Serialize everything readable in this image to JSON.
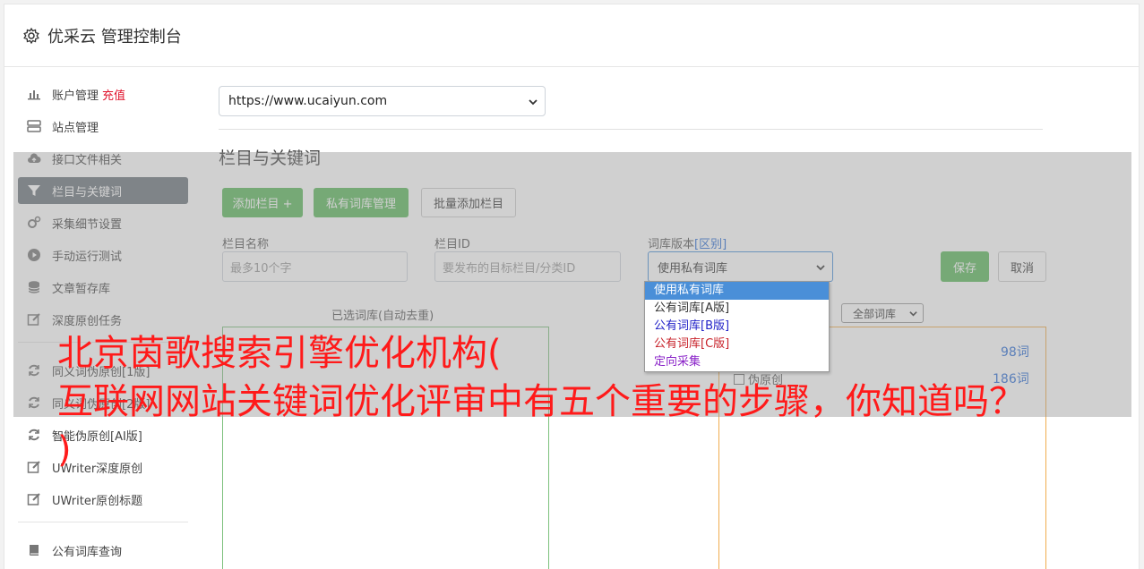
{
  "header": {
    "title": "优采云 管理控制台"
  },
  "sidebar": {
    "items": [
      {
        "label": "账户管理",
        "extra": "充值"
      },
      {
        "label": "站点管理"
      },
      {
        "label": "接口文件相关"
      },
      {
        "label": "栏目与关键词"
      },
      {
        "label": "采集细节设置"
      },
      {
        "label": "手动运行测试"
      },
      {
        "label": "文章暂存库"
      },
      {
        "label": "深度原创任务"
      },
      {
        "label": "同义词伪原创[1版]"
      },
      {
        "label": "同义词伪原创[2版]"
      },
      {
        "label": "智能伪原创[AI版]"
      },
      {
        "label": "UWriter深度原创"
      },
      {
        "label": "UWriter原创标题"
      },
      {
        "label": "公有词库查询"
      }
    ]
  },
  "main": {
    "site_select_value": "https://www.ucaiyun.com",
    "section_title": "栏目与关键词",
    "buttons": {
      "add_column": "添加栏目 +",
      "private_dict": "私有词库管理",
      "batch_add": "批量添加栏目",
      "save": "保存",
      "cancel": "取消"
    },
    "fields": {
      "column_name_label": "栏目名称",
      "column_name_placeholder": "最多10个字",
      "column_id_label": "栏目ID",
      "column_id_placeholder": "要发布的目标栏目/分类ID",
      "dict_version_label": "词库版本",
      "dict_version_link": "[区别]",
      "dict_version_value": "使用私有词库"
    },
    "dropdown_options": [
      "使用私有词库",
      "公有词库[A版]",
      "公有词库[B版]",
      "公有词库[C版]",
      "定向采集"
    ],
    "selected_box_label": "已选词库(自动去重)",
    "all_dict_select": "全部词库",
    "dict_rows": [
      {
        "label": "伪原创",
        "count": "186词"
      }
    ],
    "dict_counts": [
      "98词"
    ]
  },
  "overlay": {
    "line1": "北京茵歌搜索引擎优化机构(",
    "line2": "互联网网站关键词优化评审中有五个重要的步骤，你知道吗？",
    "line3": ")"
  },
  "colors": {
    "active_nav": "#6c757d",
    "green": "#5cb85c",
    "accent_red": "#e0132c",
    "link_blue": "#2a6cd6",
    "overlay_red": "#ff1a1a"
  }
}
